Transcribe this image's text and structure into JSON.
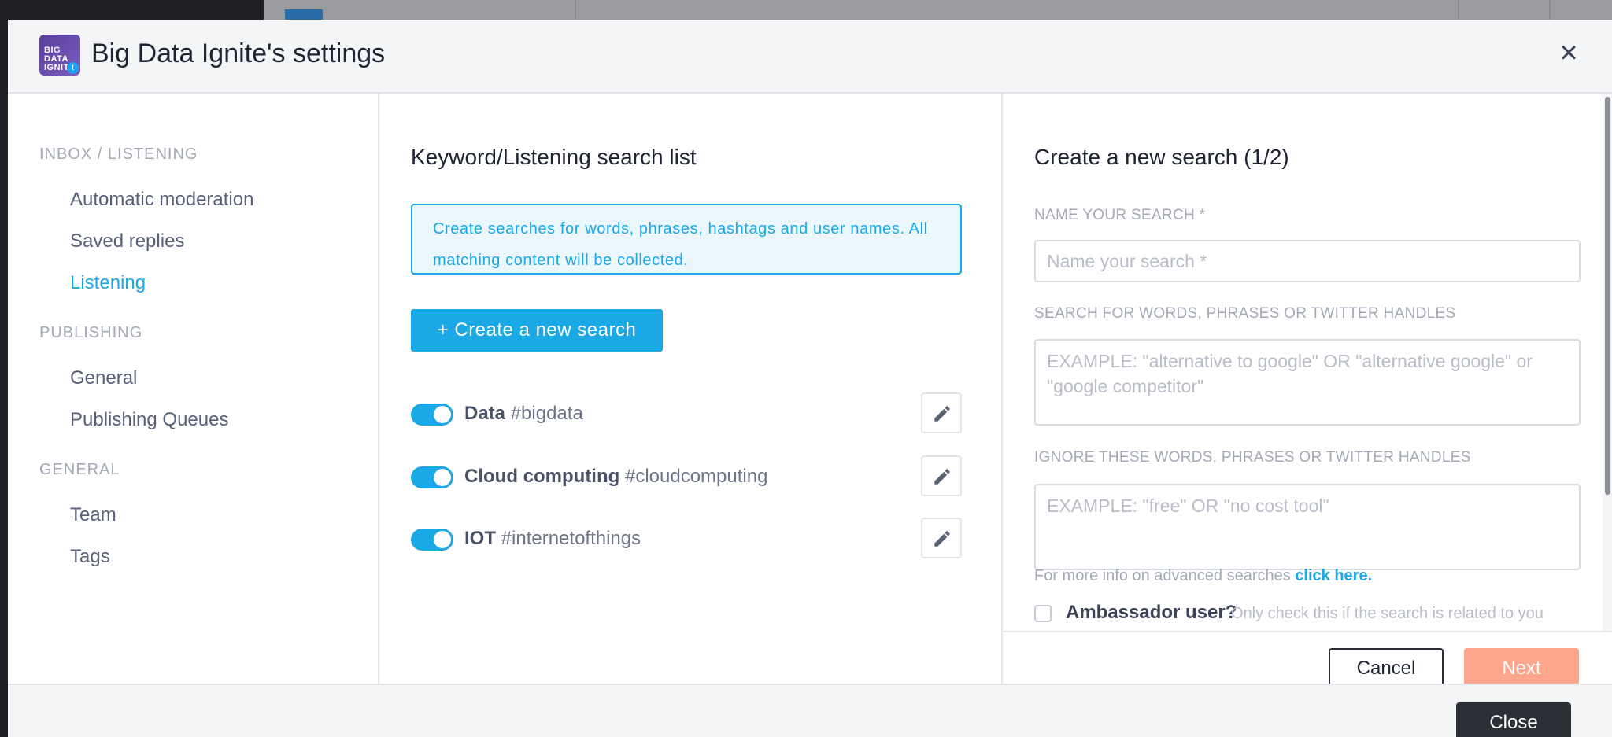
{
  "modal": {
    "title": "Big Data Ignite's settings",
    "avatar_text": "BIG DATA IGNITE",
    "avatar_badge_icon": "twitter-icon",
    "close_icon": "close-icon",
    "footer_close_label": "Close"
  },
  "sidebar": {
    "sections": [
      {
        "heading": "INBOX / LISTENING",
        "items": [
          {
            "label": "Automatic moderation",
            "active": false
          },
          {
            "label": "Saved replies",
            "active": false
          },
          {
            "label": "Listening",
            "active": true
          }
        ]
      },
      {
        "heading": "PUBLISHING",
        "items": [
          {
            "label": "General",
            "active": false
          },
          {
            "label": "Publishing Queues",
            "active": false
          }
        ]
      },
      {
        "heading": "GENERAL",
        "items": [
          {
            "label": "Team",
            "active": false
          },
          {
            "label": "Tags",
            "active": false
          }
        ]
      }
    ]
  },
  "search_list": {
    "title": "Keyword/Listening search list",
    "info": "Create searches for words, phrases, hashtags and user names. All matching content will be collected.",
    "create_label": "+ Create a new search",
    "items": [
      {
        "name": "Data",
        "tag": "#bigdata",
        "enabled": true
      },
      {
        "name": "Cloud computing",
        "tag": "#cloudcomputing",
        "enabled": true
      },
      {
        "name": "IOT",
        "tag": "#internetofthings",
        "enabled": true
      }
    ],
    "edit_icon": "pencil-icon"
  },
  "new_search": {
    "title": "Create a new search (1/2)",
    "name_label": "NAME YOUR SEARCH *",
    "name_placeholder": "Name your search *",
    "name_value": "",
    "words_label": "SEARCH FOR WORDS, PHRASES OR TWITTER HANDLES",
    "words_placeholder": "EXAMPLE: \"alternative to google\" OR \"alternative google\" or \"google competitor\"",
    "words_value": "",
    "ignore_label": "IGNORE THESE WORDS, PHRASES OR TWITTER HANDLES",
    "ignore_placeholder": "EXAMPLE: \"free\" OR \"no cost tool\"",
    "ignore_value": "",
    "more_info_text": "For more info on advanced searches",
    "more_info_link": "click here.",
    "ambassador_label": "Ambassador user?",
    "ambassador_hint": "Only check this if the search is related to you",
    "ambassador_checked": false,
    "cancel_label": "Cancel",
    "next_label": "Next"
  },
  "colors": {
    "accent": "#1ba9e5",
    "next_button": "#fda68c",
    "close_button": "#2c2f36"
  }
}
